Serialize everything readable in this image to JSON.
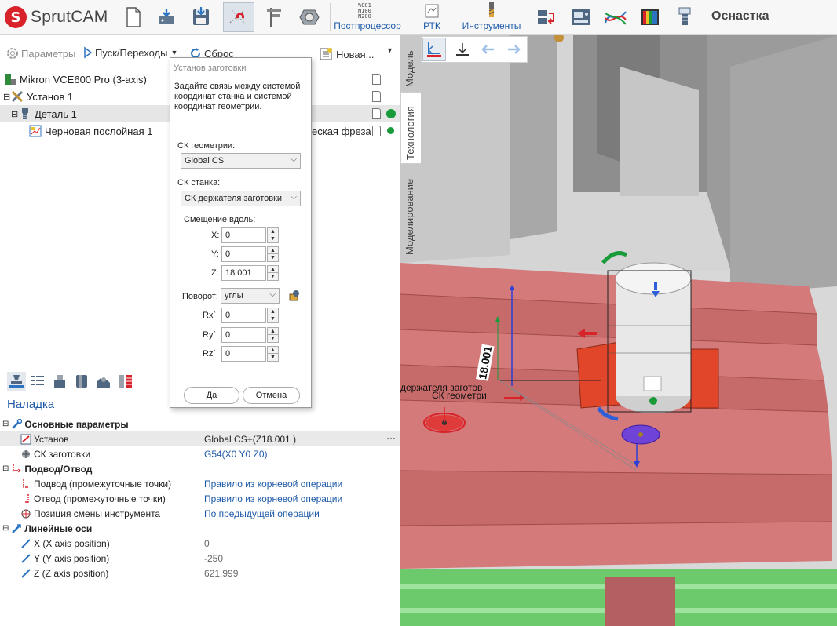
{
  "app": {
    "name": "SprutCAM",
    "right_title": "Оснастка"
  },
  "toolbar": {
    "postprocessor_label": "Постпроцессор",
    "postprocessor_codes": [
      "%001",
      "N100",
      "N200"
    ],
    "rtk_label": "РТК",
    "tools_label": "Инструменты"
  },
  "ops_toolbar": {
    "params_label": "Параметры",
    "run_label": "Пуск/Переходы",
    "reset_label": "Сброс",
    "new_label": "Новая..."
  },
  "tree": {
    "machine": "Mikron VCE600 Pro (3-axis)",
    "setup": "Установ 1",
    "part": "Деталь 1",
    "operation": "Черновая послойная 1",
    "operation_suffix": "еская фреза"
  },
  "dialog": {
    "title": "Установ заготовки",
    "description": "Задайте связь между системой координат станка и системой координат геометрии.",
    "geom_cs_label": "СК геометрии:",
    "geom_cs_value": "Global CS",
    "machine_cs_label": "СК станка:",
    "machine_cs_value": "СК держателя заготовки",
    "offset_label": "Смещение вдоль:",
    "x_label": "X:",
    "x_value": "0",
    "y_label": "Y:",
    "y_value": "0",
    "z_label": "Z:",
    "z_value": "18.001",
    "rotation_label": "Поворот:",
    "rotation_value": "углы",
    "rx_label": "Rx`",
    "rx_value": "0",
    "ry_label": "Ry`",
    "ry_value": "0",
    "rz_label": "Rz`",
    "rz_value": "0",
    "ok_label": "Да",
    "cancel_label": "Отмена"
  },
  "props": {
    "section_title": "Наладка",
    "basic_group": "Основные параметры",
    "setup_name": "Установ",
    "setup_value": "Global CS+(Z18.001 )",
    "setup_more": "···",
    "workpiece_cs_name": "СК заготовки",
    "workpiece_cs_value": "G54(X0 Y0 Z0)",
    "approach_group": "Подвод/Отвод",
    "approach_name": "Подвод (промежуточные точки)",
    "approach_value": "Правило из корневой операции",
    "retract_name": "Отвод (промежуточные точки)",
    "retract_value": "Правило из корневой операции",
    "toolchange_name": "Позиция смены инструмента",
    "toolchange_value": "По предыдущей операции",
    "axes_group": "Линейные оси",
    "x_name": "X (X axis position)",
    "x_value": "0",
    "y_name": "Y (Y axis position)",
    "y_value": "-250",
    "z_name": "Z (Z axis position)",
    "z_value": "621.999"
  },
  "viewport": {
    "vtabs": [
      "Модель",
      "Технология",
      "Моделирование"
    ],
    "active_vtab": "Технология",
    "label_holder": "держателя заготов",
    "label_geom": "СК геометри",
    "dim_label": "18.001"
  },
  "colors": {
    "brand_red": "#d8232a",
    "link_blue": "#1e5aa8",
    "table_pink": "#d47a7a",
    "clamp_red": "#e2462a",
    "green_status": "#1a9b3a"
  }
}
